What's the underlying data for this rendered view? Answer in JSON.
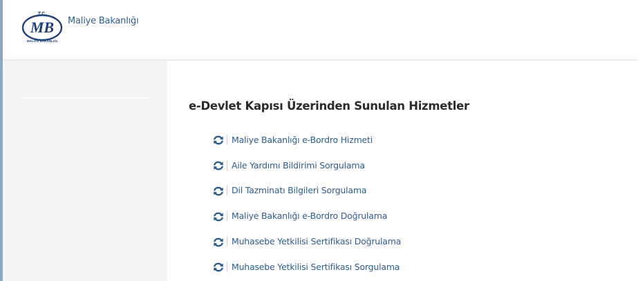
{
  "header": {
    "logo_icon": "ministry-logo-icon",
    "logo_text": {
      "top": "T.C.",
      "main": "MB",
      "bottom": "MALİYE BAKANLIĞI"
    },
    "agency_name": "Maliye Bakanlığı"
  },
  "main": {
    "section_title": "e-Devlet Kapısı Üzerinden Sunulan Hizmetler",
    "services": [
      {
        "label": "Maliye Bakanlığı e-Bordro Hizmeti",
        "icon": "refresh-icon"
      },
      {
        "label": "Aile Yardımı Bildirimi Sorgulama",
        "icon": "refresh-icon"
      },
      {
        "label": "Dil Tazminatı Bilgileri Sorgulama",
        "icon": "refresh-icon"
      },
      {
        "label": "Maliye Bakanlığı e-Bordro Doğrulama",
        "icon": "refresh-icon"
      },
      {
        "label": "Muhasebe Yetkilisi Sertifikası Doğrulama",
        "icon": "refresh-icon"
      },
      {
        "label": "Muhasebe Yetkilisi Sertifikası Sorgulama",
        "icon": "refresh-icon"
      }
    ]
  },
  "colors": {
    "link": "#2e5d8a",
    "icon": "#2e5d8a",
    "sidebar_bg": "#f3f4f6",
    "accent_bar": "#8fa6c3"
  }
}
